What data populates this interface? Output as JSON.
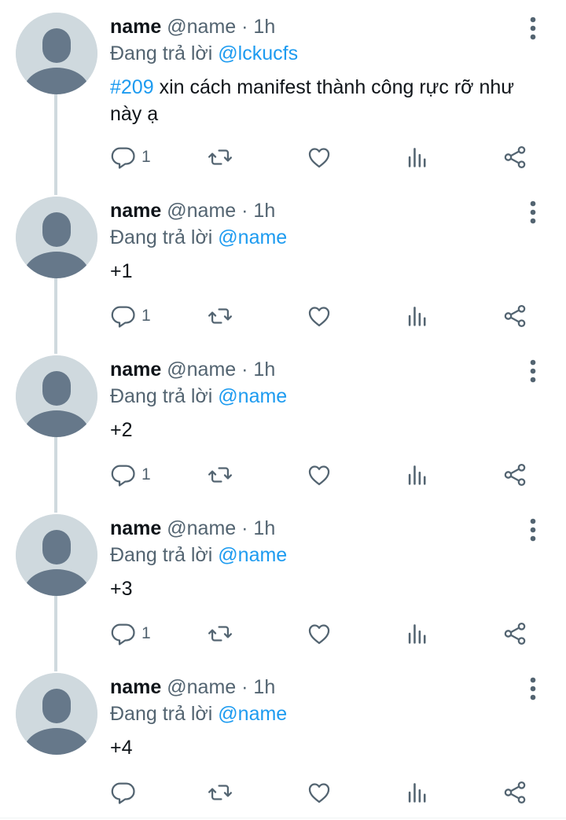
{
  "tweets": [
    {
      "name": "name",
      "handle": "@name",
      "separator": "·",
      "time": "1h",
      "reply_label": "Đang trả lời",
      "reply_to": "@lckucfs",
      "hashtag": "#209",
      "text": " xin cách manifest thành công rực rỡ như này ạ",
      "reply_count": "1"
    },
    {
      "name": "name",
      "handle": "@name",
      "separator": "·",
      "time": "1h",
      "reply_label": "Đang trả lời",
      "reply_to": "@name",
      "hashtag": "",
      "text": "+1",
      "reply_count": "1"
    },
    {
      "name": "name",
      "handle": "@name",
      "separator": "·",
      "time": "1h",
      "reply_label": "Đang trả lời",
      "reply_to": "@name",
      "hashtag": "",
      "text": "+2",
      "reply_count": "1"
    },
    {
      "name": "name",
      "handle": "@name",
      "separator": "·",
      "time": "1h",
      "reply_label": "Đang trả lời",
      "reply_to": "@name",
      "hashtag": "",
      "text": "+3",
      "reply_count": "1"
    },
    {
      "name": "name",
      "handle": "@name",
      "separator": "·",
      "time": "1h",
      "reply_label": "Đang trả lời",
      "reply_to": "@name",
      "hashtag": "",
      "text": "+4",
      "reply_count": ""
    }
  ],
  "icons": {
    "more": "more-vertical-icon",
    "reply": "reply-bubble-icon",
    "retweet": "retweet-icon",
    "like": "heart-icon",
    "views": "views-bar-chart-icon",
    "share": "share-icon"
  },
  "colors": {
    "link": "#1d9bf0",
    "secondary_text": "#536471",
    "primary_text": "#0f1419",
    "avatar_bg": "#cfd9de",
    "avatar_figure": "#66788a",
    "thread_line": "#cfd9de"
  }
}
